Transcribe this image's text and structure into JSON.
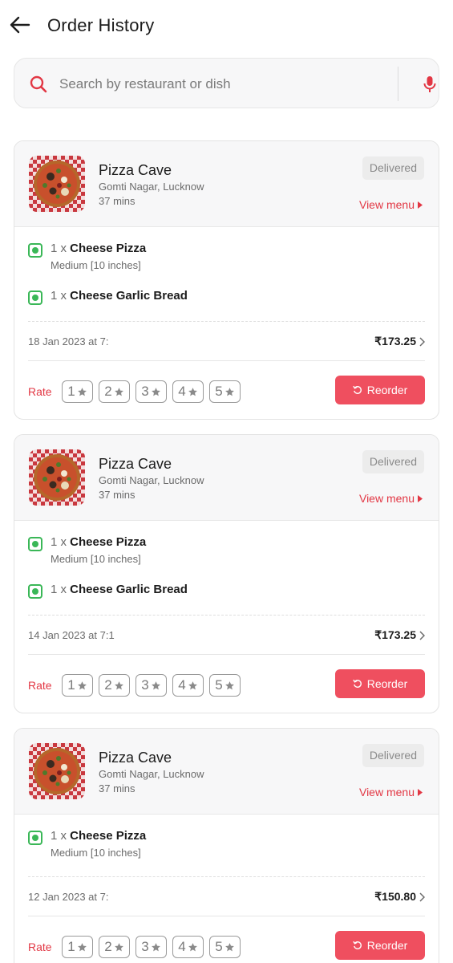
{
  "header": {
    "title": "Order History"
  },
  "search": {
    "placeholder": "Search by restaurant or dish"
  },
  "colors": {
    "accent": "#e23744",
    "button": "#ef4f5f",
    "veg": "#3ab757"
  },
  "icons": [
    "back-arrow-icon",
    "search-icon",
    "mic-icon",
    "caret-right-icon",
    "chevron-right-icon",
    "star-icon",
    "reorder-icon",
    "veg-icon"
  ],
  "orders": [
    {
      "restaurant": "Pizza Cave",
      "location": "Gomti Nagar, Lucknow",
      "eta": "37 mins",
      "status": "Delivered",
      "view_menu": "View menu",
      "items": [
        {
          "qty": "1 x",
          "name": "Cheese Pizza",
          "variant": "Medium [10 inches]"
        },
        {
          "qty": "1 x",
          "name": "Cheese Garlic Bread",
          "variant": ""
        }
      ],
      "date": "18 Jan 2023 at 7:",
      "total": "₹173.25",
      "rate_label": "Rate",
      "ratings": [
        "1",
        "2",
        "3",
        "4",
        "5"
      ],
      "reorder": "Reorder"
    },
    {
      "restaurant": "Pizza Cave",
      "location": "Gomti Nagar, Lucknow",
      "eta": "37 mins",
      "status": "Delivered",
      "view_menu": "View menu",
      "items": [
        {
          "qty": "1 x",
          "name": "Cheese Pizza",
          "variant": "Medium [10 inches]"
        },
        {
          "qty": "1 x",
          "name": "Cheese Garlic Bread",
          "variant": ""
        }
      ],
      "date": "14 Jan 2023 at 7:1",
      "total": "₹173.25",
      "rate_label": "Rate",
      "ratings": [
        "1",
        "2",
        "3",
        "4",
        "5"
      ],
      "reorder": "Reorder"
    },
    {
      "restaurant": "Pizza Cave",
      "location": "Gomti Nagar, Lucknow",
      "eta": "37 mins",
      "status": "Delivered",
      "view_menu": "View menu",
      "items": [
        {
          "qty": "1 x",
          "name": "Cheese Pizza",
          "variant": "Medium [10 inches]"
        }
      ],
      "date": "12 Jan 2023 at 7:",
      "total": "₹150.80",
      "rate_label": "Rate",
      "ratings": [
        "1",
        "2",
        "3",
        "4",
        "5"
      ],
      "reorder": "Reorder"
    }
  ]
}
